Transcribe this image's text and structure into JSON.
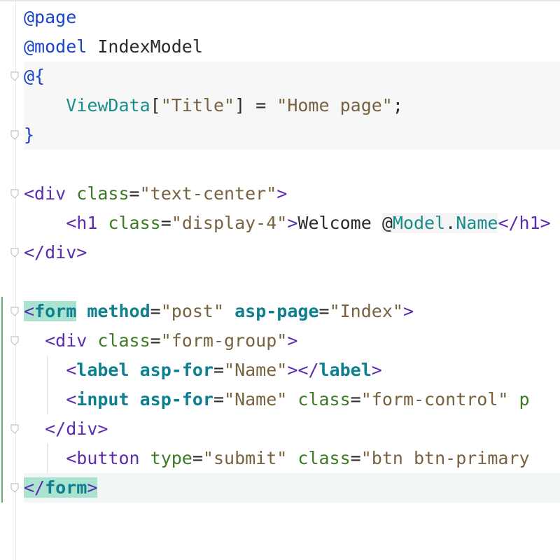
{
  "editor": {
    "language": "razor",
    "lines": [
      {
        "tokens": [
          {
            "t": "@page",
            "c": "dir"
          }
        ]
      },
      {
        "tokens": [
          {
            "t": "@model",
            "c": "dir"
          },
          {
            "t": " IndexModel",
            "c": "txt"
          }
        ]
      },
      {
        "fold": true,
        "bg": "razor",
        "tokens": [
          {
            "t": "@{",
            "c": "sym"
          }
        ]
      },
      {
        "bg": "razor",
        "tokens": [
          {
            "t": "    ",
            "c": "txt"
          },
          {
            "t": "ViewData",
            "c": "ident"
          },
          {
            "t": "[",
            "c": "txt"
          },
          {
            "t": "\"Title\"",
            "c": "str"
          },
          {
            "t": "] = ",
            "c": "txt"
          },
          {
            "t": "\"Home page\"",
            "c": "str"
          },
          {
            "t": ";",
            "c": "txt"
          }
        ]
      },
      {
        "fold": true,
        "bg": "razor",
        "tokens": [
          {
            "t": "}",
            "c": "sym"
          }
        ]
      },
      {
        "tokens": []
      },
      {
        "fold": true,
        "tokens": [
          {
            "t": "<div ",
            "c": "tag"
          },
          {
            "t": "class",
            "c": "attr"
          },
          {
            "t": "=",
            "c": "txt"
          },
          {
            "t": "\"text-center\"",
            "c": "str"
          },
          {
            "t": ">",
            "c": "tag"
          }
        ]
      },
      {
        "tokens": [
          {
            "t": "    ",
            "c": "txt"
          },
          {
            "t": "<h1 ",
            "c": "tag"
          },
          {
            "t": "class",
            "c": "attr"
          },
          {
            "t": "=",
            "c": "txt"
          },
          {
            "t": "\"display-4\"",
            "c": "str"
          },
          {
            "t": ">",
            "c": "tag"
          },
          {
            "t": "Welcome ",
            "c": "txt"
          },
          {
            "t": "@",
            "c": "txt hlbg"
          },
          {
            "t": "Model",
            "c": "ident hlbg"
          },
          {
            "t": ".",
            "c": "txt hlbg"
          },
          {
            "t": "Name",
            "c": "ident hlbg"
          },
          {
            "t": "</h1>",
            "c": "tag"
          }
        ]
      },
      {
        "fold": true,
        "tokens": [
          {
            "t": "</div>",
            "c": "tag"
          }
        ]
      },
      {
        "tokens": []
      },
      {
        "fold": true,
        "tokens": [
          {
            "t": "<",
            "c": "tag hl"
          },
          {
            "t": "form",
            "c": "tagb hl"
          },
          {
            "t": " ",
            "c": "txt"
          },
          {
            "t": "method",
            "c": "attrb"
          },
          {
            "t": "=",
            "c": "txt"
          },
          {
            "t": "\"post\"",
            "c": "str"
          },
          {
            "t": " ",
            "c": "txt"
          },
          {
            "t": "asp-page",
            "c": "attrb"
          },
          {
            "t": "=",
            "c": "txt"
          },
          {
            "t": "\"Index\"",
            "c": "str"
          },
          {
            "t": ">",
            "c": "tag"
          }
        ]
      },
      {
        "fold": true,
        "tokens": [
          {
            "t": "  ",
            "c": "txt"
          },
          {
            "t": "<div ",
            "c": "tag"
          },
          {
            "t": "class",
            "c": "attr"
          },
          {
            "t": "=",
            "c": "txt"
          },
          {
            "t": "\"form-group\"",
            "c": "str"
          },
          {
            "t": ">",
            "c": "tag"
          }
        ]
      },
      {
        "tokens": [
          {
            "t": "    ",
            "c": "txt"
          },
          {
            "t": "<",
            "c": "tag"
          },
          {
            "t": "label",
            "c": "tagb"
          },
          {
            "t": " ",
            "c": "txt"
          },
          {
            "t": "asp-for",
            "c": "attrb"
          },
          {
            "t": "=",
            "c": "txt"
          },
          {
            "t": "\"Name\"",
            "c": "str"
          },
          {
            "t": "></",
            "c": "tag"
          },
          {
            "t": "label",
            "c": "tagb"
          },
          {
            "t": ">",
            "c": "tag"
          }
        ]
      },
      {
        "tokens": [
          {
            "t": "    ",
            "c": "txt"
          },
          {
            "t": "<",
            "c": "tag"
          },
          {
            "t": "input",
            "c": "tagb"
          },
          {
            "t": " ",
            "c": "txt"
          },
          {
            "t": "asp-for",
            "c": "attrb"
          },
          {
            "t": "=",
            "c": "txt"
          },
          {
            "t": "\"Name\"",
            "c": "str"
          },
          {
            "t": " ",
            "c": "txt"
          },
          {
            "t": "class",
            "c": "attr"
          },
          {
            "t": "=",
            "c": "txt"
          },
          {
            "t": "\"form-control\"",
            "c": "str"
          },
          {
            "t": " p",
            "c": "attr"
          }
        ]
      },
      {
        "fold": true,
        "tokens": [
          {
            "t": "  ",
            "c": "txt"
          },
          {
            "t": "</div>",
            "c": "tag"
          }
        ]
      },
      {
        "tokens": [
          {
            "t": "    ",
            "c": "txt"
          },
          {
            "t": "<button ",
            "c": "tag"
          },
          {
            "t": "type",
            "c": "attr"
          },
          {
            "t": "=",
            "c": "txt"
          },
          {
            "t": "\"submit\"",
            "c": "str"
          },
          {
            "t": " ",
            "c": "txt"
          },
          {
            "t": "class",
            "c": "attr"
          },
          {
            "t": "=",
            "c": "txt"
          },
          {
            "t": "\"btn btn-primary",
            "c": "str"
          }
        ]
      },
      {
        "fold": true,
        "bg": "caret",
        "tokens": [
          {
            "t": "</",
            "c": "tag hl"
          },
          {
            "t": "form",
            "c": "tagb hl"
          },
          {
            "t": ">",
            "c": "tag hl"
          }
        ]
      }
    ]
  }
}
